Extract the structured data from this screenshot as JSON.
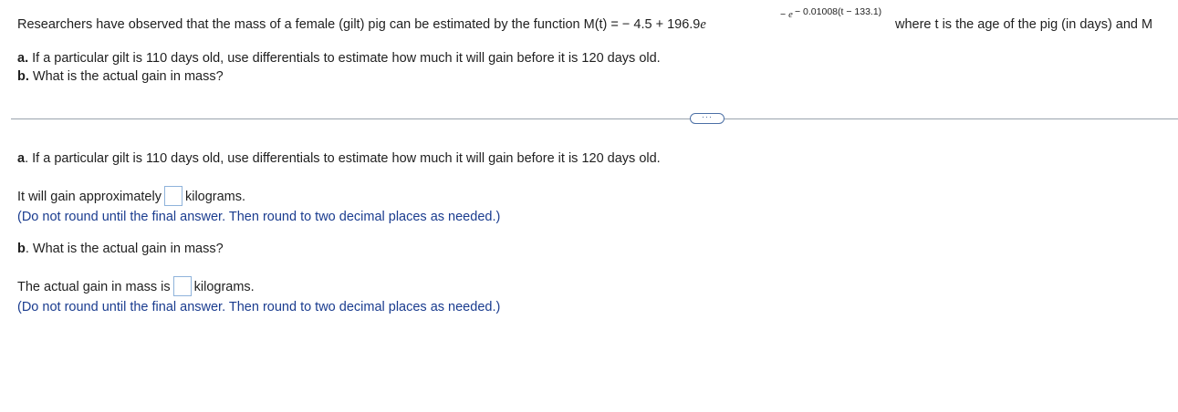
{
  "problem": {
    "intro_prefix": "Researchers have observed that the mass of a female (gilt) pig can be estimated by the function M(t) = − 4.5 + 196.9",
    "e_base1": "e",
    "exp_minus": "−",
    "e_base2": "e",
    "exp_inner": "− 0.01008(t − 133.1)",
    "intro_suffix": "where t is the age of the pig (in days) and M",
    "part_a_letter": "a.",
    "part_a_text": "If a particular gilt is 110 days old, use differentials to estimate how much it will gain before it is 120 days old.",
    "part_b_letter": "b.",
    "part_b_text": "What is the actual gain in mass?"
  },
  "divider": {
    "more_label": "···"
  },
  "answers": {
    "part_a_letter": "a",
    "part_a_question": ". If a particular gilt is 110 days old, use differentials to estimate how much it will gain before it is 120 days old.",
    "part_a_prefix": "It will gain approximately",
    "part_a_value": "",
    "part_a_suffix": "kilograms.",
    "part_a_hint": "(Do not round until the final answer. Then round to two decimal places as needed.)",
    "part_b_letter": "b",
    "part_b_question": ". What is the actual gain in mass?",
    "part_b_prefix": "The actual gain in mass is",
    "part_b_value": "",
    "part_b_suffix": "kilograms.",
    "part_b_hint": "(Do not round until the final answer. Then round to two decimal places as needed.)"
  }
}
